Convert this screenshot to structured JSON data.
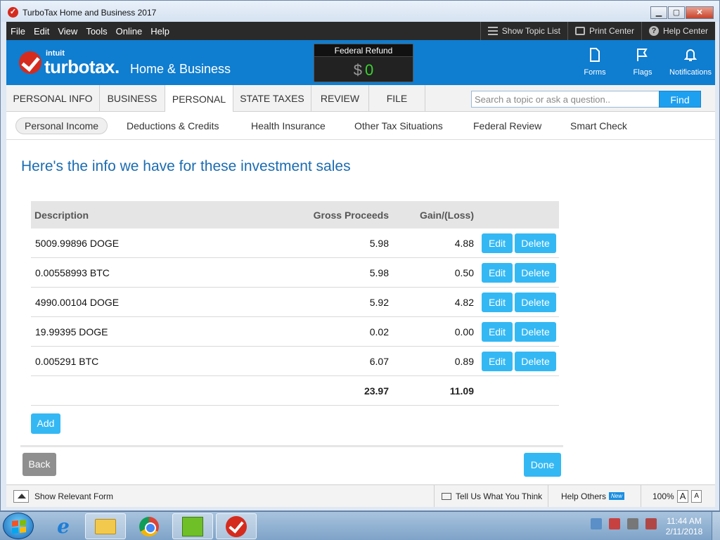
{
  "window": {
    "title": "TurboTax Home and Business 2017"
  },
  "menu": {
    "items": [
      "File",
      "Edit",
      "View",
      "Tools",
      "Online",
      "Help"
    ],
    "right": {
      "topic_list": "Show Topic List",
      "print_center": "Print Center",
      "help_center": "Help Center"
    }
  },
  "header": {
    "brand_intuit": "intuit",
    "brand_name": "turbotax.",
    "edition": "Home & Business",
    "refund_label": "Federal Refund",
    "refund_currency": "$",
    "refund_value": "0",
    "icons": {
      "forms": "Forms",
      "flags": "Flags",
      "notifications": "Notifications"
    }
  },
  "tabs": [
    {
      "label": "PERSONAL INFO"
    },
    {
      "label": "BUSINESS"
    },
    {
      "label": "PERSONAL"
    },
    {
      "label": "STATE TAXES"
    },
    {
      "label": "REVIEW"
    },
    {
      "label": "FILE"
    }
  ],
  "search": {
    "placeholder": "Search a topic or ask a question..",
    "button": "Find"
  },
  "subtabs": [
    {
      "label": "Personal Income"
    },
    {
      "label": "Deductions & Credits"
    },
    {
      "label": "Health Insurance"
    },
    {
      "label": "Other Tax Situations"
    },
    {
      "label": "Federal Review"
    },
    {
      "label": "Smart Check"
    }
  ],
  "page": {
    "title": "Here's the info we have for these investment sales",
    "columns": {
      "description": "Description",
      "proceeds": "Gross Proceeds",
      "gain": "Gain/(Loss)"
    },
    "rows": [
      {
        "description": "5009.99896 DOGE",
        "proceeds": "5.98",
        "gain": "4.88"
      },
      {
        "description": "0.00558993 BTC",
        "proceeds": "5.98",
        "gain": "0.50"
      },
      {
        "description": "4990.00104 DOGE",
        "proceeds": "5.92",
        "gain": "4.82"
      },
      {
        "description": "19.99395 DOGE",
        "proceeds": "0.02",
        "gain": "0.00"
      },
      {
        "description": "0.005291 BTC",
        "proceeds": "6.07",
        "gain": "0.89"
      }
    ],
    "totals": {
      "proceeds": "23.97",
      "gain": "11.09"
    },
    "edit_label": "Edit",
    "delete_label": "Delete",
    "add_label": "Add",
    "back_label": "Back",
    "done_label": "Done"
  },
  "statusbar": {
    "show_form": "Show Relevant Form",
    "feedback": "Tell Us What You Think",
    "help_others": "Help Others",
    "new_badge": "New",
    "zoom": "100%",
    "zoom_large": "A",
    "zoom_small": "A"
  },
  "taskbar": {
    "time": "11:44 AM",
    "date": "2/11/2018"
  },
  "colors": {
    "brand_blue": "#0f7dd0",
    "accent_button": "#34b8f4",
    "title_blue": "#1b6cb1",
    "refund_green": "#3bd12f"
  }
}
